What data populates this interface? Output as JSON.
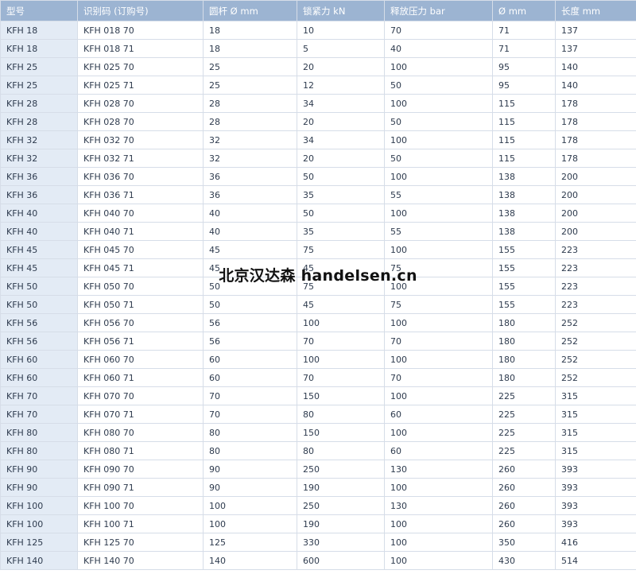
{
  "table": {
    "headers": [
      "型号",
      "识别码 (订购号)",
      "圆杆 Ø mm",
      "锁紧力 kN",
      "释放压力 bar",
      "Ø mm",
      "长度 mm"
    ],
    "rows": [
      [
        "KFH 18",
        "KFH 018 70",
        "18",
        "10",
        "70",
        "71",
        "137"
      ],
      [
        "KFH 18",
        "KFH 018 71",
        "18",
        "5",
        "40",
        "71",
        "137"
      ],
      [
        "KFH 25",
        "KFH 025 70",
        "25",
        "20",
        "100",
        "95",
        "140"
      ],
      [
        "KFH 25",
        "KFH 025 71",
        "25",
        "12",
        "50",
        "95",
        "140"
      ],
      [
        "KFH 28",
        "KFH 028 70",
        "28",
        "34",
        "100",
        "115",
        "178"
      ],
      [
        "KFH 28",
        "KFH 028 70",
        "28",
        "20",
        "50",
        "115",
        "178"
      ],
      [
        "KFH 32",
        "KFH 032 70",
        "32",
        "34",
        "100",
        "115",
        "178"
      ],
      [
        "KFH 32",
        "KFH 032 71",
        "32",
        "20",
        "50",
        "115",
        "178"
      ],
      [
        "KFH 36",
        "KFH 036 70",
        "36",
        "50",
        "100",
        "138",
        "200"
      ],
      [
        "KFH 36",
        "KFH 036 71",
        "36",
        "35",
        "55",
        "138",
        "200"
      ],
      [
        "KFH 40",
        "KFH 040 70",
        "40",
        "50",
        "100",
        "138",
        "200"
      ],
      [
        "KFH 40",
        "KFH 040 71",
        "40",
        "35",
        "55",
        "138",
        "200"
      ],
      [
        "KFH 45",
        "KFH 045 70",
        "45",
        "75",
        "100",
        "155",
        "223"
      ],
      [
        "KFH 45",
        "KFH 045 71",
        "45",
        "45",
        "75",
        "155",
        "223"
      ],
      [
        "KFH 50",
        "KFH 050 70",
        "50",
        "75",
        "100",
        "155",
        "223"
      ],
      [
        "KFH 50",
        "KFH 050 71",
        "50",
        "45",
        "75",
        "155",
        "223"
      ],
      [
        "KFH 56",
        "KFH 056 70",
        "56",
        "100",
        "100",
        "180",
        "252"
      ],
      [
        "KFH 56",
        "KFH 056 71",
        "56",
        "70",
        "70",
        "180",
        "252"
      ],
      [
        "KFH 60",
        "KFH 060 70",
        "60",
        "100",
        "100",
        "180",
        "252"
      ],
      [
        "KFH 60",
        "KFH 060 71",
        "60",
        "70",
        "70",
        "180",
        "252"
      ],
      [
        "KFH 70",
        "KFH 070 70",
        "70",
        "150",
        "100",
        "225",
        "315"
      ],
      [
        "KFH 70",
        "KFH 070 71",
        "70",
        "80",
        "60",
        "225",
        "315"
      ],
      [
        "KFH 80",
        "KFH 080 70",
        "80",
        "150",
        "100",
        "225",
        "315"
      ],
      [
        "KFH 80",
        "KFH 080 71",
        "80",
        "80",
        "60",
        "225",
        "315"
      ],
      [
        "KFH 90",
        "KFH 090 70",
        "90",
        "250",
        "130",
        "260",
        "393"
      ],
      [
        "KFH 90",
        "KFH 090 71",
        "90",
        "190",
        "100",
        "260",
        "393"
      ],
      [
        "KFH 100",
        "KFH 100 70",
        "100",
        "250",
        "130",
        "260",
        "393"
      ],
      [
        "KFH 100",
        "KFH 100 71",
        "100",
        "190",
        "100",
        "260",
        "393"
      ],
      [
        "KFH 125",
        "KFH 125 70",
        "125",
        "330",
        "100",
        "350",
        "416"
      ],
      [
        "KFH 140",
        "KFH 140 70",
        "140",
        "600",
        "100",
        "430",
        "514"
      ]
    ]
  },
  "watermark": "北京汉达森 handelsen.cn",
  "colors": {
    "header_bg": "#9cb4d2",
    "first_col_bg": "#e3ebf5",
    "text": "#2e3b4e",
    "border": "#d6dde8"
  }
}
